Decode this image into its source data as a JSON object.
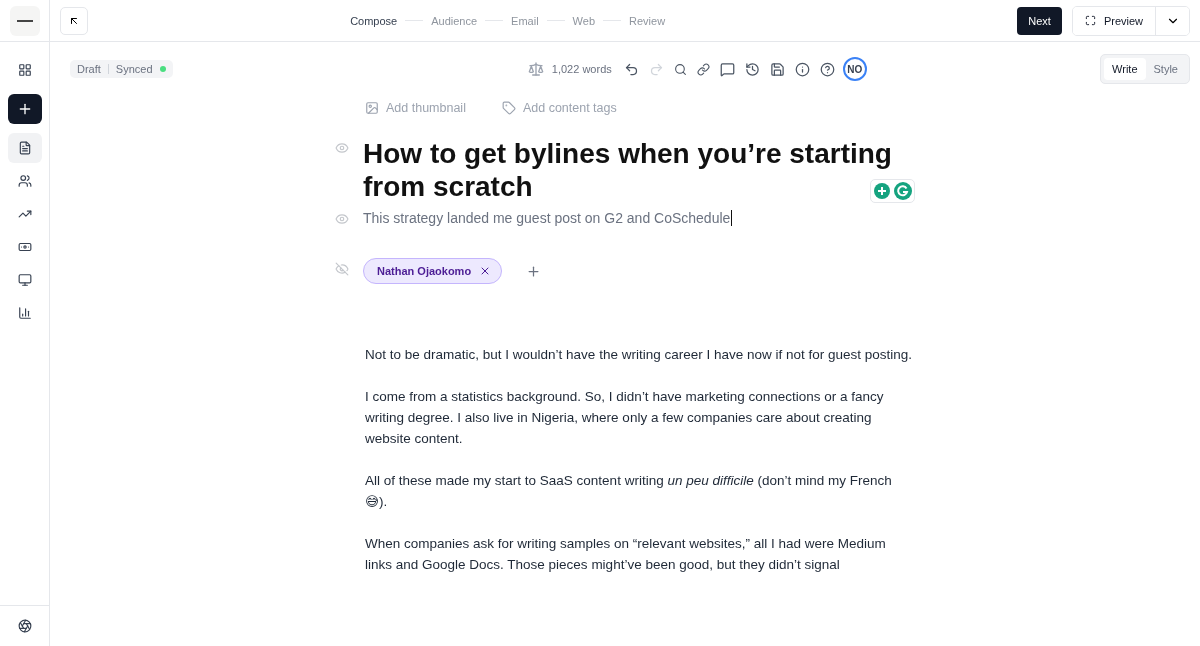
{
  "steps": [
    {
      "label": "Compose",
      "selected": true
    },
    {
      "label": "Audience",
      "selected": false
    },
    {
      "label": "Email",
      "selected": false
    },
    {
      "label": "Web",
      "selected": false
    },
    {
      "label": "Review",
      "selected": false
    }
  ],
  "header_buttons": {
    "next": "Next",
    "preview": "Preview"
  },
  "sidebar": {
    "items": [
      {
        "kind": "apps",
        "selected": false
      },
      {
        "kind": "new",
        "selected": false
      },
      {
        "kind": "document",
        "selected": true
      },
      {
        "kind": "audience",
        "selected": false
      },
      {
        "kind": "growth",
        "selected": false
      },
      {
        "kind": "monetize",
        "selected": false
      },
      {
        "kind": "website",
        "selected": false
      },
      {
        "kind": "analytics",
        "selected": false
      }
    ]
  },
  "status": {
    "draft": "Draft",
    "sync": "Synced",
    "synced": true
  },
  "toolbar": {
    "word_count": "1,022 words",
    "redo_disabled": true,
    "avatar": "NO"
  },
  "mode_tabs": [
    {
      "label": "Write",
      "selected": true
    },
    {
      "label": "Style",
      "selected": false
    }
  ],
  "meta_actions": [
    {
      "kind": "thumbnail",
      "label": "Add thumbnail"
    },
    {
      "kind": "tags",
      "label": "Add content tags"
    }
  ],
  "title": {
    "text": "How to get bylines when you’re starting from scratch",
    "visible": true
  },
  "subtitle": {
    "text": "This strategy landed me guest post on G2 and CoSchedule",
    "visible": true
  },
  "authors": {
    "visible": false,
    "items": [
      "Nathan Ojaokomo"
    ]
  },
  "body": [
    "Not to be dramatic, but I wouldn’t have the writing career I have now if not for guest posting.",
    "I come from a statistics background. So, I didn’t have marketing connections or a fancy writing degree. I also live in Nigeria, where only a few companies care about creating website content.",
    "All of these made my start to SaaS content writing *un peu difficile* (don’t mind my French 😅).",
    "When companies ask for writing samples on “relevant websites,” all I had were Medium links and Google Docs. Those pieces might’ve been good, but they didn’t signal"
  ]
}
